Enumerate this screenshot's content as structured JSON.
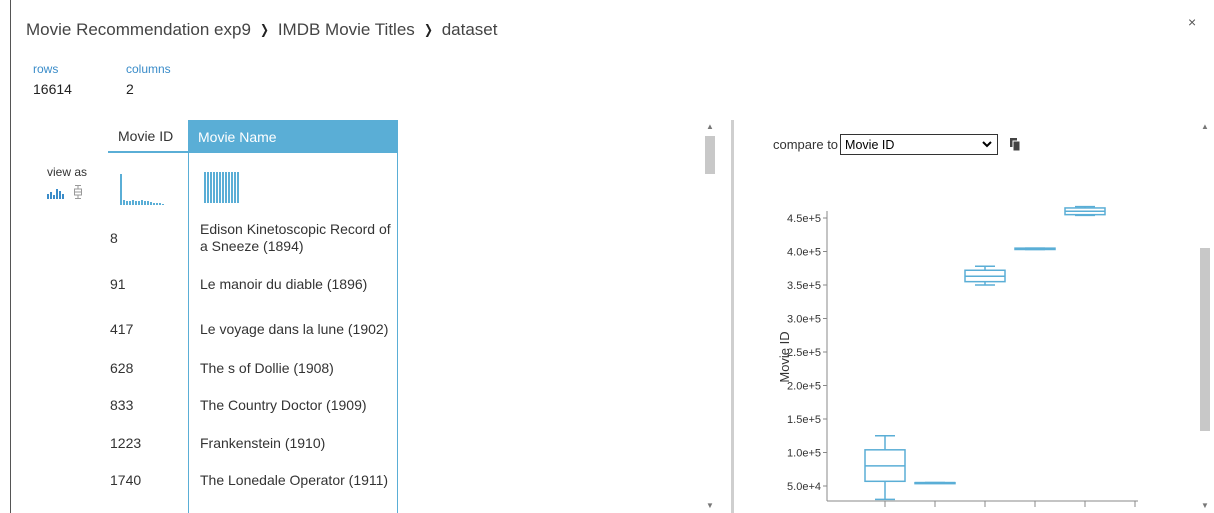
{
  "breadcrumb": {
    "items": [
      "Movie Recommendation exp9",
      "IMDB Movie Titles",
      "dataset"
    ],
    "separator": "›"
  },
  "close_label": "×",
  "stats": {
    "rows_label": "rows",
    "rows_value": "16614",
    "columns_label": "columns",
    "columns_value": "2"
  },
  "view_as": {
    "label": "view as",
    "icons": [
      "histogram-icon",
      "boxplot-icon"
    ]
  },
  "table": {
    "headers": [
      "Movie ID",
      "Movie Name"
    ],
    "rows": [
      {
        "id": "8",
        "name": "Edison Kinetoscopic Record of a Sneeze (1894)"
      },
      {
        "id": "91",
        "name": "Le manoir du diable (1896)"
      },
      {
        "id": "417",
        "name": "Le voyage dans la lune (1902)"
      },
      {
        "id": "628",
        "name": "The s of Dollie (1908)"
      },
      {
        "id": "833",
        "name": "The Country Doctor (1909)"
      },
      {
        "id": "1223",
        "name": "Frankenstein (1910)"
      },
      {
        "id": "1740",
        "name": "The Lonedale Operator (1911)"
      }
    ]
  },
  "compare": {
    "label": "compare to",
    "selected": "Movie ID"
  },
  "colors": {
    "accent": "#5aaed6",
    "link": "#3a8cc9",
    "chart": "#5aaed6"
  },
  "chart_data": {
    "type": "boxplot",
    "ylabel": "Movie ID",
    "yticks": [
      "5.0e+4",
      "1.0e+5",
      "1.5e+5",
      "2.0e+5",
      "2.5e+5",
      "3.0e+5",
      "3.5e+5",
      "4.0e+5",
      "4.5e+5"
    ],
    "boxes": [
      {
        "whisker_low": 30000,
        "q1": 57000,
        "median": 80000,
        "q3": 104000,
        "whisker_high": 125000
      },
      {
        "whisker_low": 55000,
        "q1": 55000,
        "median": 55000,
        "q3": 55000,
        "whisker_high": 55000
      },
      {
        "whisker_low": 350000,
        "q1": 355000,
        "median": 363000,
        "q3": 372000,
        "whisker_high": 378000
      },
      {
        "whisker_low": 403000,
        "q1": 403000,
        "median": 404000,
        "q3": 405000,
        "whisker_high": 405000
      },
      {
        "whisker_low": 454000,
        "q1": 455000,
        "median": 460000,
        "q3": 465000,
        "whisker_high": 467000
      }
    ]
  }
}
